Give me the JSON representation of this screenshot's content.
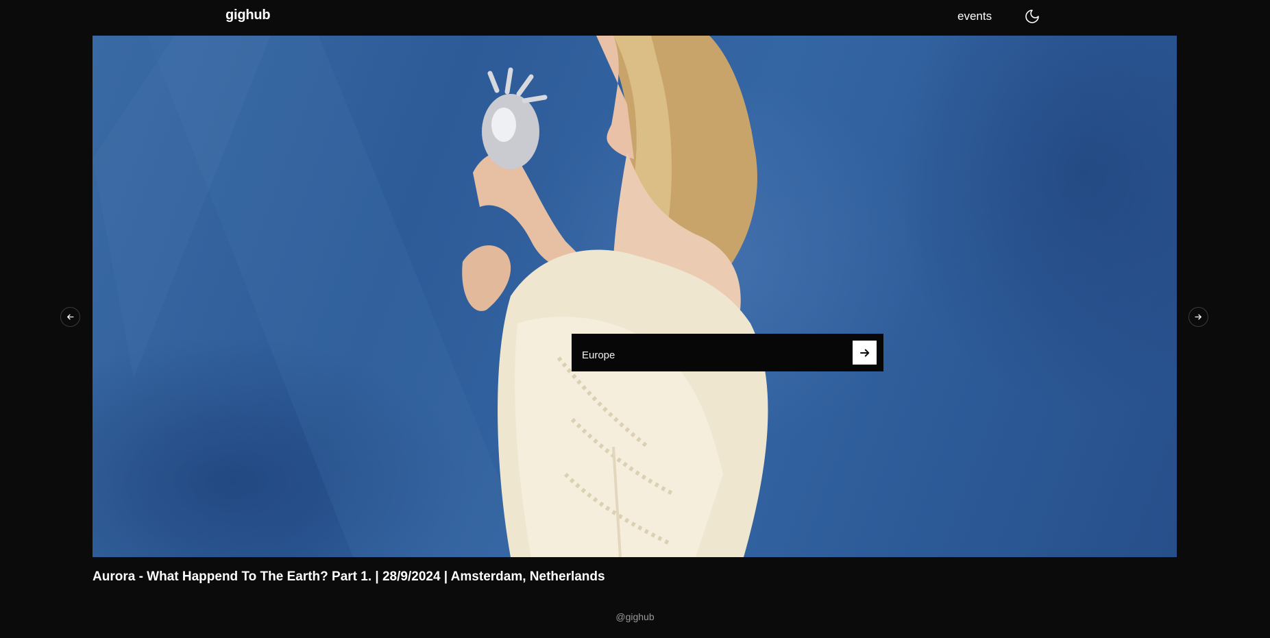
{
  "header": {
    "logo": "gighub",
    "nav_events": "events",
    "theme_icon": "moon-icon"
  },
  "hero": {
    "search": {
      "value": "Europe",
      "submit_icon": "arrow-right-icon"
    },
    "prev_icon": "arrow-left-icon",
    "next_icon": "arrow-right-icon",
    "caption": "Aurora - What Happend To The Earth? Part 1. | 28/9/2024 | Amsterdam, Netherlands"
  },
  "footer": {
    "handle": "@gighub"
  },
  "colors": {
    "background": "#0b0b0b",
    "hero_blue": "#2d5b98",
    "text": "#ffffff",
    "muted": "#9a9a9a"
  }
}
